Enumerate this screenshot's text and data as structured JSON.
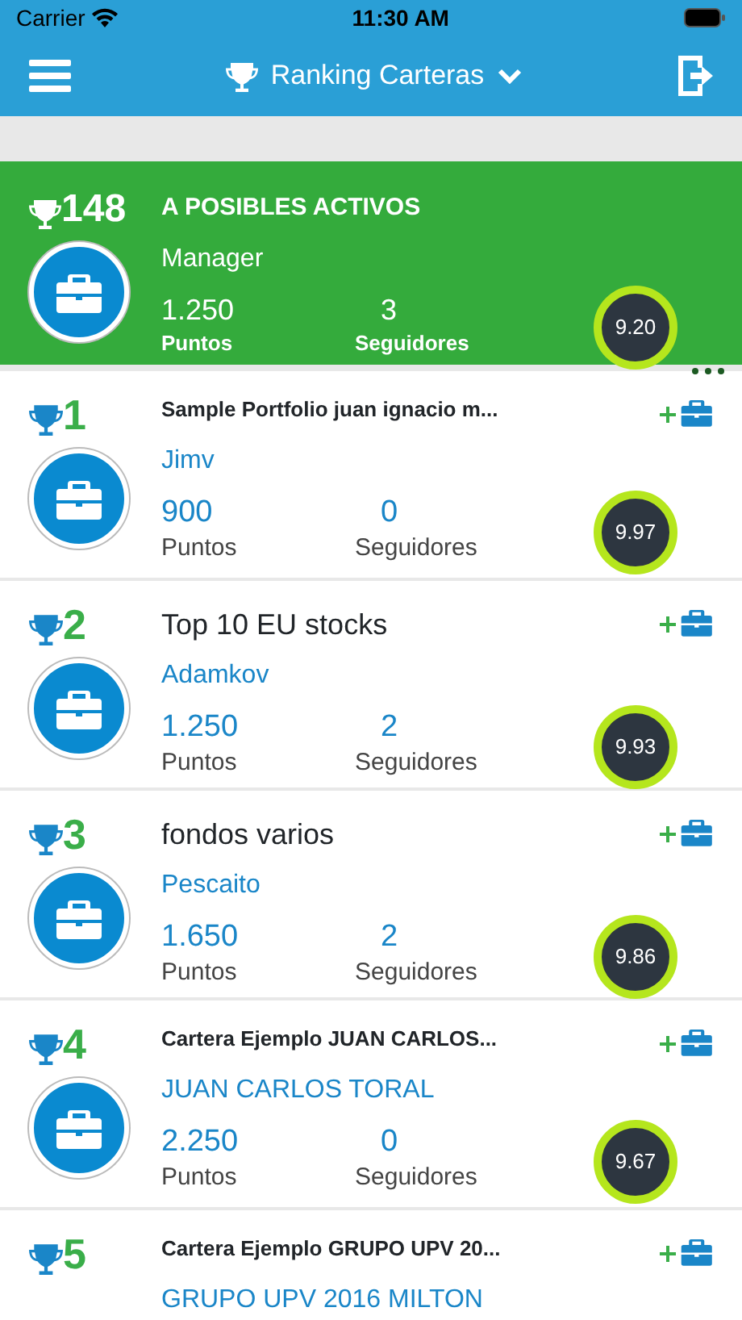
{
  "status_bar": {
    "carrier": "Carrier",
    "time": "11:30 AM"
  },
  "nav": {
    "title": "Ranking Carteras"
  },
  "my_portfolio": {
    "rank": "148",
    "title": "A POSIBLES ACTIVOS",
    "subtitle": "Manager",
    "points": "1.250",
    "points_label": "Puntos",
    "followers": "3",
    "followers_label": "Seguidores",
    "score": "9.20"
  },
  "rankings": [
    {
      "rank": "1",
      "title": "Sample Portfolio juan ignacio m...",
      "kind": "compact",
      "owner": "Jimv",
      "points": "900",
      "points_label": "Puntos",
      "followers": "0",
      "followers_label": "Seguidores",
      "score": "9.97"
    },
    {
      "rank": "2",
      "title": "Top 10 EU stocks",
      "kind": "full",
      "owner": "Adamkov",
      "points": "1.250",
      "points_label": "Puntos",
      "followers": "2",
      "followers_label": "Seguidores",
      "score": "9.93"
    },
    {
      "rank": "3",
      "title": "fondos varios",
      "kind": "full",
      "owner": "Pescaito",
      "points": "1.650",
      "points_label": "Puntos",
      "followers": "2",
      "followers_label": "Seguidores",
      "score": "9.86"
    },
    {
      "rank": "4",
      "title": "Cartera Ejemplo JUAN CARLOS...",
      "kind": "compact",
      "owner": "JUAN CARLOS TORAL",
      "points": "2.250",
      "points_label": "Puntos",
      "followers": "0",
      "followers_label": "Seguidores",
      "score": "9.67"
    },
    {
      "rank": "5",
      "title": "Cartera Ejemplo GRUPO UPV 20...",
      "kind": "compact",
      "owner": "GRUPO UPV 2016 MILTON"
    }
  ]
}
